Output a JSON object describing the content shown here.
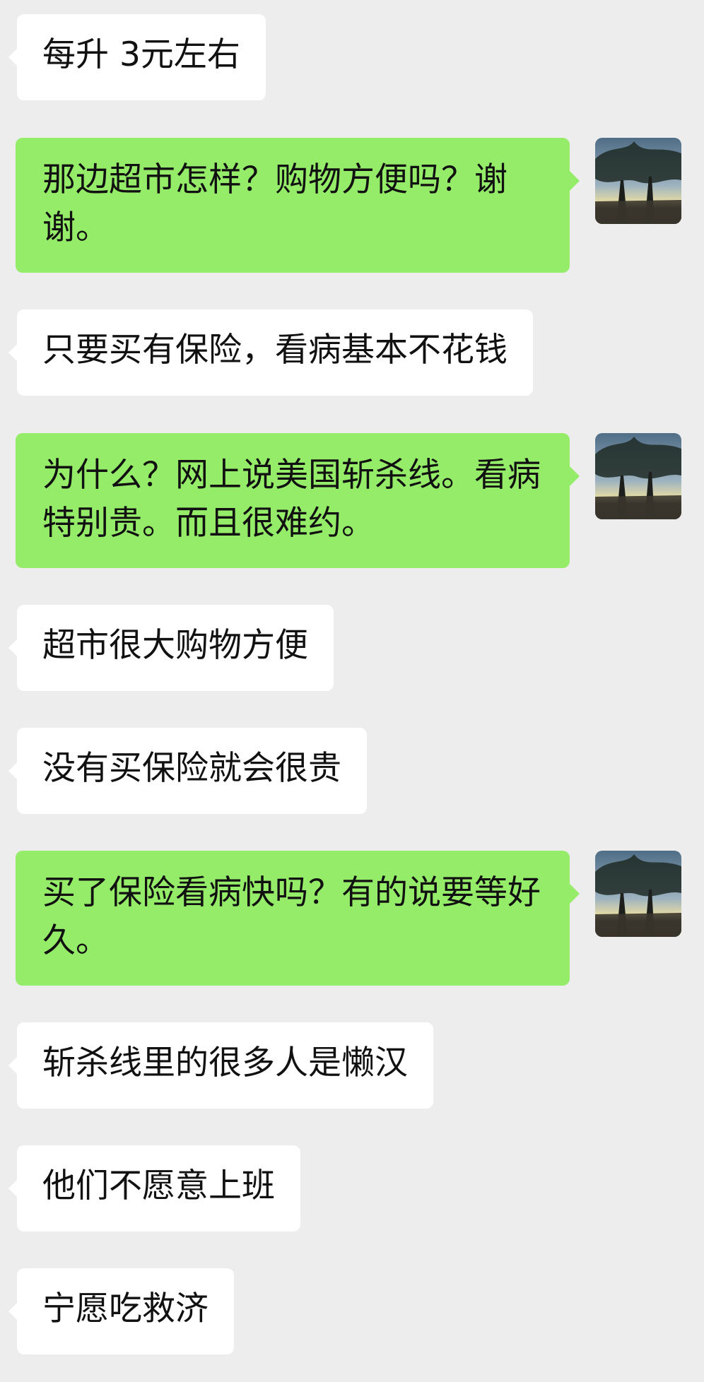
{
  "conversation": {
    "messages": [
      {
        "side": "in",
        "text": "每升 3元左右"
      },
      {
        "side": "out",
        "text": "那边超市怎样？购物方便吗？谢谢。",
        "avatar_icon": "landscape-avatar-icon"
      },
      {
        "side": "in",
        "text": "只要买有保险，看病基本不花钱"
      },
      {
        "side": "out",
        "text": "为什么？网上说美国斩杀线。看病特别贵。而且很难约。",
        "avatar_icon": "landscape-avatar-icon"
      },
      {
        "side": "in",
        "text": "超市很大购物方便"
      },
      {
        "side": "in",
        "text": "没有买保险就会很贵"
      },
      {
        "side": "out",
        "text": "买了保险看病快吗？有的说要等好久。",
        "avatar_icon": "landscape-avatar-icon"
      },
      {
        "side": "in",
        "text": "斩杀线里的很多人是懒汉"
      },
      {
        "side": "in",
        "text": "他们不愿意上班"
      },
      {
        "side": "in",
        "text": "宁愿吃救济"
      }
    ]
  },
  "colors": {
    "background": "#ededed",
    "incoming_bubble": "#ffffff",
    "outgoing_bubble": "#95ec69",
    "text": "#111111"
  }
}
